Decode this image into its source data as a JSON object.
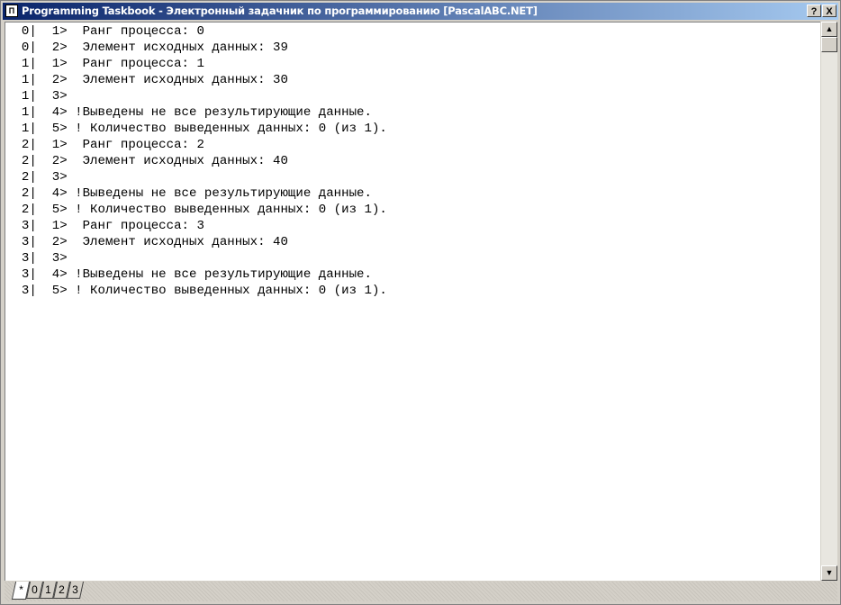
{
  "window": {
    "title": "Programming Taskbook - Электронный задачник по программированию [PascalABC.NET]",
    "icon_name": "taskbook-icon",
    "help_button": "?",
    "close_button": "X"
  },
  "output_lines": [
    "  0|  1>  Ранг процесса: 0",
    "  0|  2>  Элемент исходных данных: 39",
    "  1|  1>  Ранг процесса: 1",
    "  1|  2>  Элемент исходных данных: 30",
    "  1|  3>",
    "  1|  4> !Выведены не все результирующие данные.",
    "  1|  5> ! Количество выведенных данных: 0 (из 1).",
    "  2|  1>  Ранг процесса: 2",
    "  2|  2>  Элемент исходных данных: 40",
    "  2|  3>",
    "  2|  4> !Выведены не все результирующие данные.",
    "  2|  5> ! Количество выведенных данных: 0 (из 1).",
    "  3|  1>  Ранг процесса: 3",
    "  3|  2>  Элемент исходных данных: 40",
    "  3|  3>",
    "  3|  4> !Выведены не все результирующие данные.",
    "  3|  5> ! Количество выведенных данных: 0 (из 1)."
  ],
  "tabs": [
    {
      "label": "*",
      "active": true
    },
    {
      "label": "0",
      "active": false
    },
    {
      "label": "1",
      "active": false
    },
    {
      "label": "2",
      "active": false
    },
    {
      "label": "3",
      "active": false
    }
  ],
  "scrollbar": {
    "up_arrow": "▲",
    "down_arrow": "▼"
  }
}
